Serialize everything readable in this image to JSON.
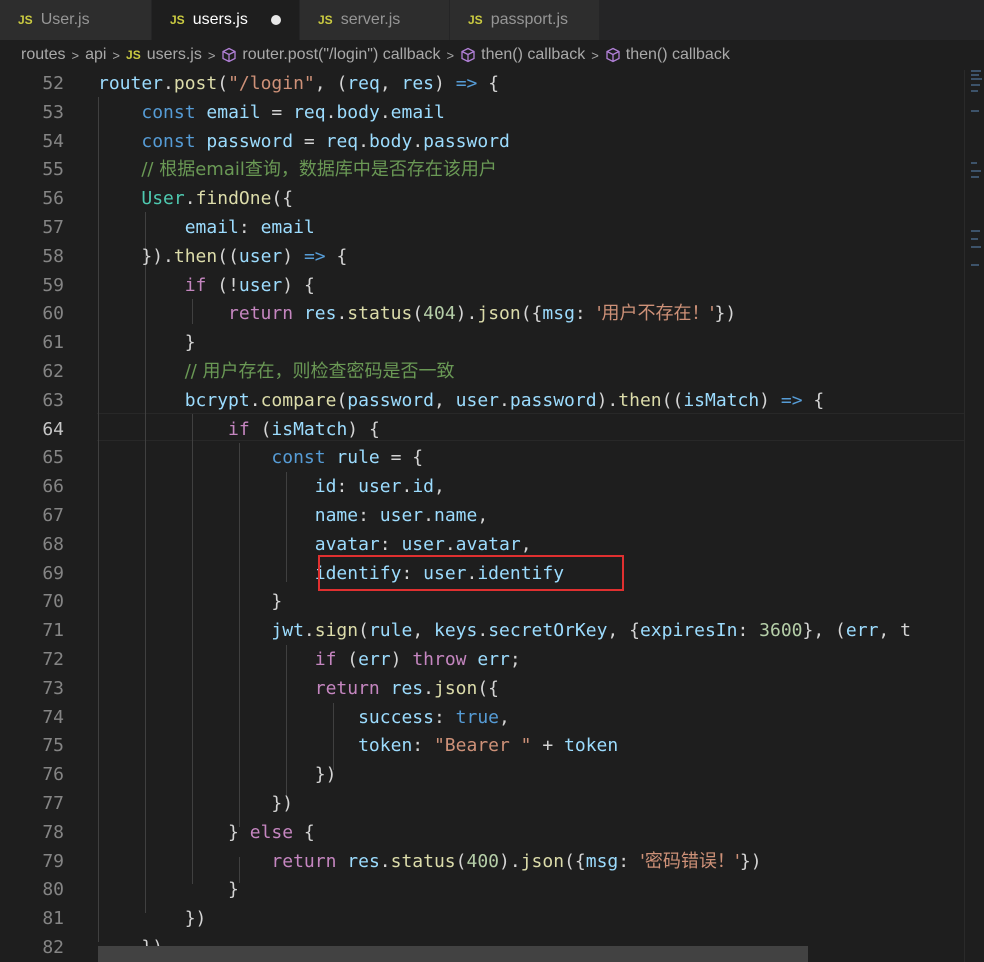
{
  "tabs": [
    {
      "icon": "JS",
      "label": "User.js"
    },
    {
      "icon": "JS",
      "label": "users.js"
    },
    {
      "icon": "JS",
      "label": "server.js"
    },
    {
      "icon": "JS",
      "label": "passport.js"
    }
  ],
  "breadcrumb": {
    "items": [
      "routes",
      "api",
      "users.js",
      "router.post(\"/login\") callback",
      "then() callback",
      "then() callback"
    ],
    "file_icon": "JS"
  },
  "editor": {
    "current_line": "64",
    "highlighted_text": "identify: user.identify",
    "lines": [
      {
        "num": "52"
      },
      {
        "num": "53"
      },
      {
        "num": "54"
      },
      {
        "num": "55"
      },
      {
        "num": "56"
      },
      {
        "num": "57"
      },
      {
        "num": "58"
      },
      {
        "num": "59"
      },
      {
        "num": "60"
      },
      {
        "num": "61"
      },
      {
        "num": "62"
      },
      {
        "num": "63"
      },
      {
        "num": "64"
      },
      {
        "num": "65"
      },
      {
        "num": "66"
      },
      {
        "num": "67"
      },
      {
        "num": "68"
      },
      {
        "num": "69"
      },
      {
        "num": "70"
      },
      {
        "num": "71"
      },
      {
        "num": "72"
      },
      {
        "num": "73"
      },
      {
        "num": "74"
      },
      {
        "num": "75"
      },
      {
        "num": "76"
      },
      {
        "num": "77"
      },
      {
        "num": "78"
      },
      {
        "num": "79"
      },
      {
        "num": "80"
      },
      {
        "num": "81"
      },
      {
        "num": "82"
      }
    ],
    "tokens": {
      "l52": [
        "router",
        ".",
        "post",
        "(",
        "\"/login\"",
        ", (",
        "req",
        ", ",
        "res",
        ") ",
        "=>",
        " {"
      ],
      "l53": [
        "const",
        " ",
        "email",
        " = ",
        "req",
        ".",
        "body",
        ".",
        "email"
      ],
      "l54": [
        "const",
        " ",
        "password",
        " = ",
        "req",
        ".",
        "body",
        ".",
        "password"
      ],
      "l55": [
        "// 根据email查询，数据库中是否存在该用户"
      ],
      "l56": [
        "User",
        ".",
        "findOne",
        "({"
      ],
      "l57": [
        "email",
        ": ",
        "email"
      ],
      "l58": [
        "}).",
        "then",
        "((",
        "user",
        ") ",
        "=>",
        " {"
      ],
      "l59": [
        "if",
        " (!",
        "user",
        ") {"
      ],
      "l60": [
        "return",
        " ",
        "res",
        ".",
        "status",
        "(",
        "404",
        ").",
        "json",
        "({",
        "msg",
        ": ",
        "'用户不存在！'",
        "})"
      ],
      "l61": [
        "}"
      ],
      "l62": [
        "// 用户存在，则检查密码是否一致"
      ],
      "l63": [
        "bcrypt",
        ".",
        "compare",
        "(",
        "password",
        ", ",
        "user",
        ".",
        "password",
        ").",
        "then",
        "((",
        "isMatch",
        ") ",
        "=>",
        " {"
      ],
      "l64": [
        "if",
        " (",
        "isMatch",
        ") {"
      ],
      "l65": [
        "const",
        " ",
        "rule",
        " = {"
      ],
      "l66": [
        "id",
        ": ",
        "user",
        ".",
        "id",
        ","
      ],
      "l67": [
        "name",
        ": ",
        "user",
        ".",
        "name",
        ","
      ],
      "l68": [
        "avatar",
        ": ",
        "user",
        ".",
        "avatar",
        ","
      ],
      "l69": [
        "identify",
        ": ",
        "user",
        ".",
        "identify"
      ],
      "l70": [
        "}"
      ],
      "l71": [
        "jwt",
        ".",
        "sign",
        "(",
        "rule",
        ", ",
        "keys",
        ".",
        "secretOrKey",
        ", {",
        "expiresIn",
        ": ",
        "3600",
        "}, (",
        "err",
        ", t"
      ],
      "l72": [
        "if",
        " (",
        "err",
        ") ",
        "throw",
        " ",
        "err",
        ";"
      ],
      "l73": [
        "return",
        " ",
        "res",
        ".",
        "json",
        "({"
      ],
      "l74": [
        "success",
        ": ",
        "true",
        ","
      ],
      "l75": [
        "token",
        ": ",
        "\"Bearer \"",
        " + ",
        "token"
      ],
      "l76": [
        "})"
      ],
      "l77": [
        "})"
      ],
      "l78": [
        "} ",
        "else",
        " {"
      ],
      "l79": [
        "return",
        " ",
        "res",
        ".",
        "status",
        "(",
        "400",
        ").",
        "json",
        "({",
        "msg",
        ": ",
        "'密码错误！'",
        "})"
      ],
      "l80": [
        "}"
      ],
      "l81": [
        "})"
      ],
      "l82": [
        "})"
      ]
    }
  },
  "colors": {
    "keyword": "#569cd6",
    "control": "#c586c0",
    "variable": "#9cdcfe",
    "function": "#dcdcaa",
    "string": "#ce9178",
    "number": "#b5cea8",
    "comment": "#6a9955",
    "type": "#4ec9b0",
    "highlight_border": "#e03030"
  }
}
